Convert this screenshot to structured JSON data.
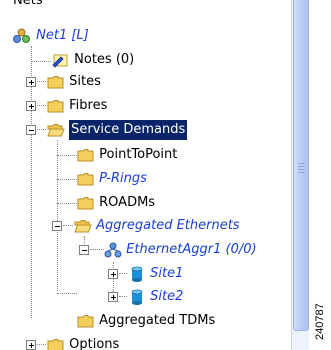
{
  "tree": {
    "partial_header": "Nets",
    "nodes": [
      {
        "id": "net1",
        "label": "Net1 [L]"
      },
      {
        "id": "notes",
        "label": "Notes (0)"
      },
      {
        "id": "sites",
        "label": "Sites"
      },
      {
        "id": "fibres",
        "label": "Fibres"
      },
      {
        "id": "service_demands",
        "label": "Service Demands",
        "selected": true
      },
      {
        "id": "point_to_point",
        "label": "PointToPoint"
      },
      {
        "id": "p_rings",
        "label": "P-Rings"
      },
      {
        "id": "roadms",
        "label": "ROADMs"
      },
      {
        "id": "aggregated_ethernets",
        "label": "Aggregated Ethernets"
      },
      {
        "id": "ethernet_aggr1",
        "label": "EthernetAggr1 (0/0)"
      },
      {
        "id": "site1",
        "label": "Site1"
      },
      {
        "id": "site2",
        "label": "Site2"
      },
      {
        "id": "aggregated_tdms",
        "label": "Aggregated TDMs"
      },
      {
        "id": "options",
        "label": "Options"
      }
    ]
  },
  "colors": {
    "selection": "#0a246a",
    "link_text": "#1a3fd6",
    "folder": "#f5cf5a",
    "scrollbar_thumb": "#bccdf3"
  },
  "figure_number": "240787"
}
